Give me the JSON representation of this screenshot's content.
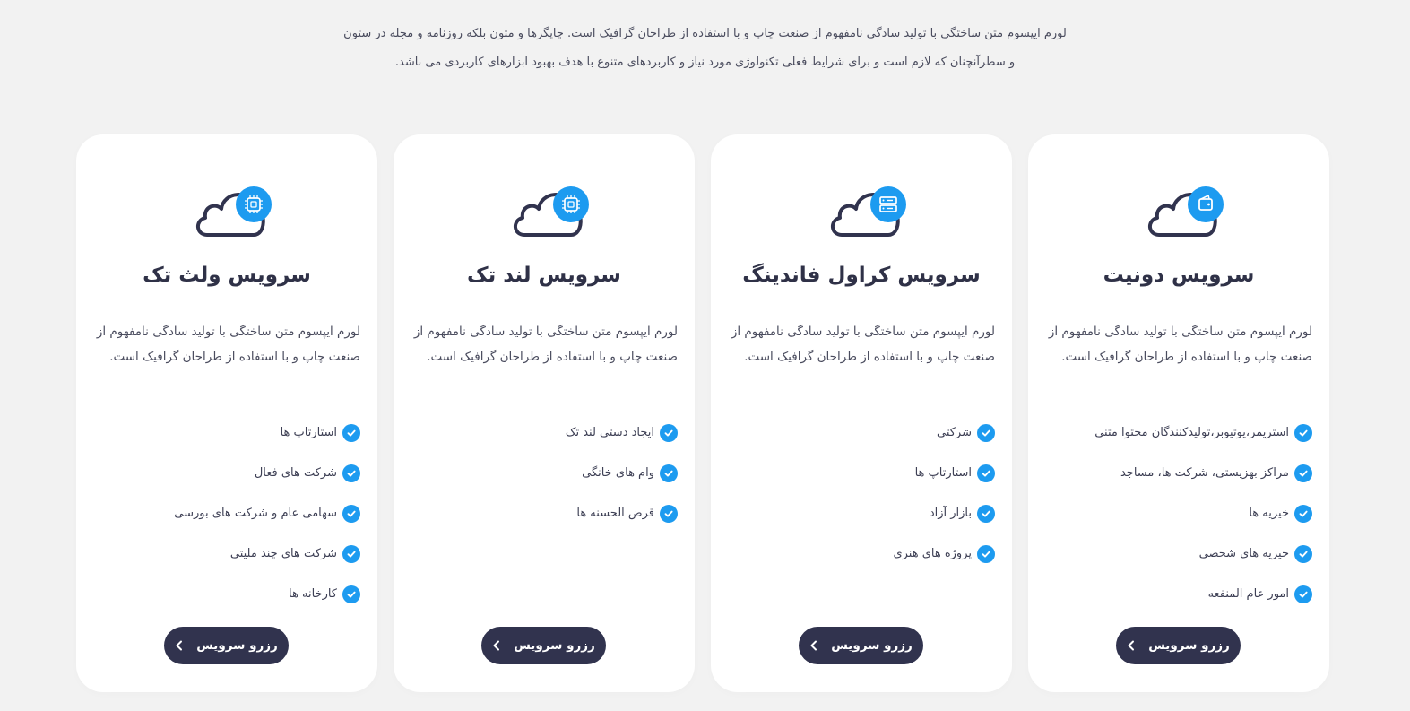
{
  "intro": {
    "line1": "لورم ایپسوم متن ساختگی با تولید سادگی نامفهوم از صنعت چاپ و با استفاده از طراحان گرافیک است. چاپگرها و متون بلکه روزنامه و مجله در ستون",
    "line2": "و سطرآنچنان که لازم است و برای شرایط فعلی تکنولوژی مورد نیاز و کاربردهای متنوع با هدف بهبود ابزارهای کاربردی می باشد."
  },
  "colors": {
    "accent": "#1d9bf0",
    "dark": "#31334e",
    "background": "#f2f2f2",
    "card": "#ffffff"
  },
  "cards": [
    {
      "badge_icon": "wallet-icon",
      "title": "سرویس دونیت",
      "desc": "لورم ایپسوم متن ساختگی با تولید سادگی نامفهوم از صنعت چاپ و با استفاده از طراحان گرافیک است.",
      "features": [
        "استریمر،یوتیوبر،تولیدکنندگان محتوا متنی",
        "مراکز بهزیستی، شرکت ها، مساجد",
        "خیریه ها",
        "خیریه های شخصی",
        "امور عام المنفعه"
      ],
      "button": "رزرو سرویس"
    },
    {
      "badge_icon": "server-icon",
      "title": "سرویس کراول فاندینگ",
      "desc": "لورم ایپسوم متن ساختگی با تولید سادگی نامفهوم از صنعت چاپ و با استفاده از طراحان گرافیک است.",
      "features": [
        "شرکتی",
        "استارتاپ ها",
        "بازار آزاد",
        "پروژه های هنری"
      ],
      "button": "رزرو سرویس"
    },
    {
      "badge_icon": "chip-icon",
      "title": "سرویس لند تک",
      "desc": "لورم ایپسوم متن ساختگی با تولید سادگی نامفهوم از صنعت چاپ و با استفاده از طراحان گرافیک است.",
      "features": [
        "ایجاد دستی لند تک",
        "وام های خانگی",
        "قرض الحسنه ها"
      ],
      "button": "رزرو سرویس"
    },
    {
      "badge_icon": "chip-icon",
      "title": "سرویس ولث تک",
      "desc": "لورم ایپسوم متن ساختگی با تولید سادگی نامفهوم از صنعت چاپ و با استفاده از طراحان گرافیک است.",
      "features": [
        "استارتاپ ها",
        "شرکت های فعال",
        "سهامی عام و شرکت های بورسی",
        "شرکت های چند ملیتی",
        "کارخانه ها"
      ],
      "button": "رزرو سرویس"
    }
  ]
}
